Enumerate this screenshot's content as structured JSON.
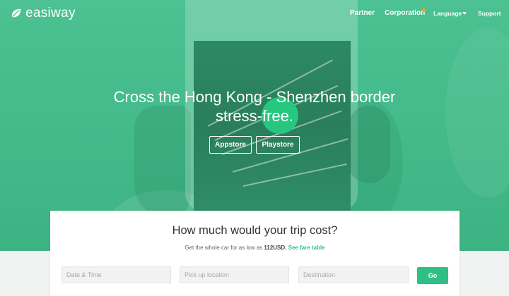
{
  "brand": {
    "name": "easiway"
  },
  "nav": {
    "partner": "Partner",
    "corporation": "Corporation",
    "language": "Language",
    "support": "Support"
  },
  "hero": {
    "headline_line1": "Cross the Hong Kong - Shenzhen border",
    "headline_line2": "stress-free.",
    "appstore_label": "Appstore",
    "playstore_label": "Playstore"
  },
  "estimate": {
    "title": "How much would your trip cost?",
    "sub_prefix": "Get the whole car for as low as ",
    "price": "112USD.",
    "fare_link": "See fare table",
    "date_placeholder": "Date & Time",
    "pickup_placeholder": "Pick up location",
    "destination_placeholder": "Destination",
    "go_label": "Go"
  },
  "colors": {
    "brand_green": "#2fbf86",
    "hero_green": "#45bb8a",
    "notification_dot": "#f5a623"
  }
}
